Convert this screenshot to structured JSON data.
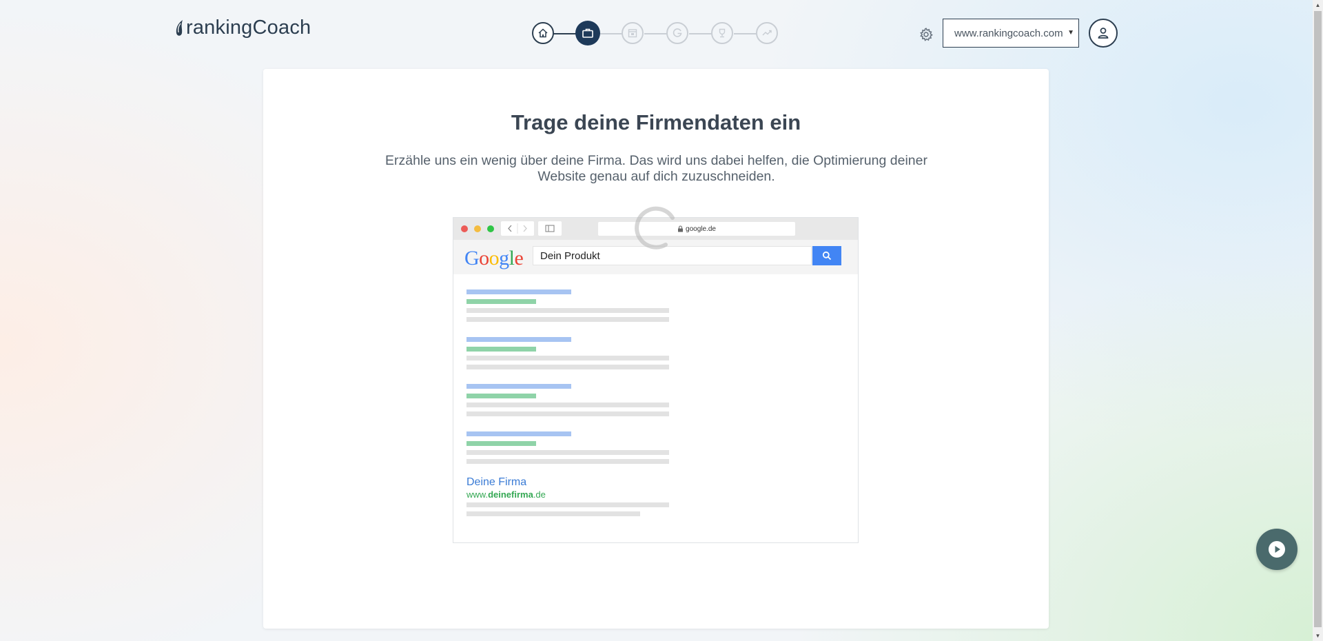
{
  "header": {
    "logo_text": "rankingCoach",
    "domain_select": {
      "value": "www.rankingcoach.com"
    },
    "steps": [
      {
        "icon": "home-icon",
        "state": "done"
      },
      {
        "icon": "briefcase-icon",
        "state": "active"
      },
      {
        "icon": "calendar-icon",
        "state": "todo"
      },
      {
        "icon": "google-g-icon",
        "state": "todo"
      },
      {
        "icon": "trophy-icon",
        "state": "todo"
      },
      {
        "icon": "trend-icon",
        "state": "todo"
      }
    ]
  },
  "main": {
    "title": "Trage deine Firmendaten ein",
    "subtitle": "Erzähle uns ein wenig über deine Firma. Das wird uns dabei helfen, die Optimierung deiner Website genau auf dich zuzuschneiden."
  },
  "illustration": {
    "url": "google.de",
    "google_logo": "Google",
    "search_query": "Dein Produkt",
    "result_title": "Deine Firma",
    "result_url_prefix": "www.",
    "result_url_bold": "deinefirma",
    "result_url_suffix": ".de"
  },
  "colors": {
    "navy": "#1e3a5a",
    "google_blue": "#4285f4",
    "play_button": "#4a6a6c"
  }
}
